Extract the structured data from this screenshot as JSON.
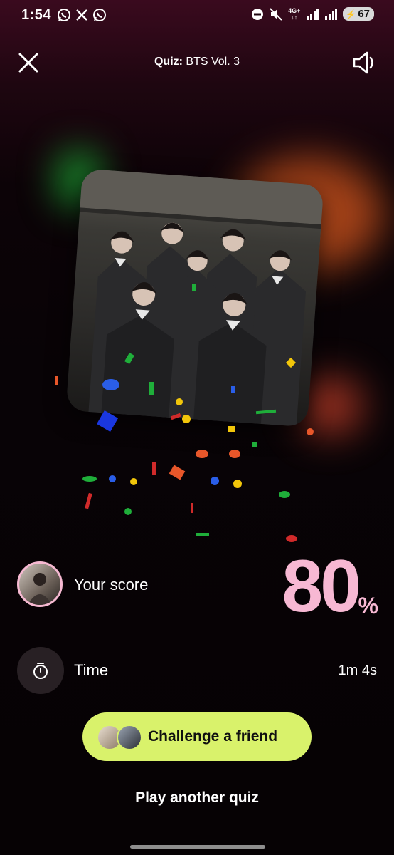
{
  "status_bar": {
    "time": "1:54",
    "network": "4G+",
    "battery": "67",
    "notification_icons": [
      "whatsapp-icon",
      "x-icon",
      "whatsapp-icon"
    ],
    "right_icons": [
      "do-not-disturb-icon",
      "mute-icon",
      "signal-icon",
      "signal-icon",
      "battery-icon"
    ]
  },
  "header": {
    "title_prefix": "Quiz:",
    "title": " BTS Vol. 3"
  },
  "result": {
    "score_label": "Your score",
    "score_value": "80",
    "score_unit": "%",
    "time_label": "Time",
    "time_value": "1m 4s"
  },
  "actions": {
    "challenge_label": "Challenge a friend",
    "play_another_label": "Play another quiz"
  },
  "colors": {
    "accent_green": "#d9f26b",
    "score_pink": "#f7b8d3",
    "background": "#080306"
  }
}
